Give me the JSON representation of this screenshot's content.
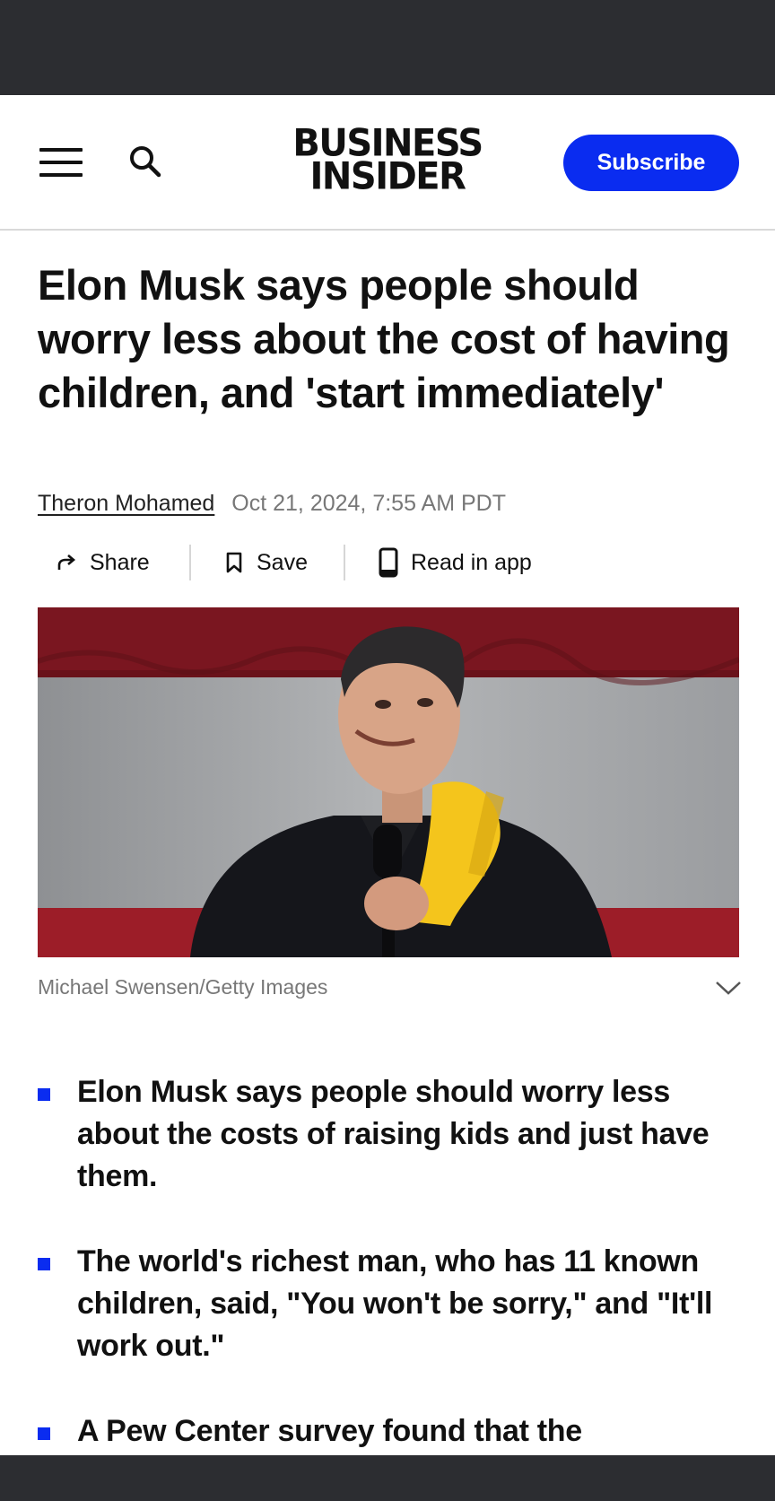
{
  "header": {
    "logo_line1": "BUSINESS",
    "logo_line2": "INSIDER",
    "subscribe_label": "Subscribe"
  },
  "article": {
    "headline": "Elon Musk says people should worry less about the cost of having children, and 'start immediately'",
    "author": "Theron Mohamed",
    "date": "Oct 21, 2024, 7:55 AM PDT",
    "actions": {
      "share": "Share",
      "save": "Save",
      "read_in_app": "Read in app"
    },
    "image_caption": "Michael Swensen/Getty Images",
    "key_points": [
      "Elon Musk says people should worry less about the costs of raising kids and just have them.",
      "The world's richest man, who has 11 known children, said, \"You won't be sorry,\" and \"It'll work out.\"",
      "A Pew Center survey found that the"
    ]
  },
  "colors": {
    "brand_blue": "#0a2cf0",
    "system_bar": "#2c2d31",
    "muted_text": "#777777"
  },
  "icons": [
    "menu-icon",
    "search-icon",
    "share-icon",
    "bookmark-icon",
    "phone-icon",
    "chevron-down-icon"
  ]
}
